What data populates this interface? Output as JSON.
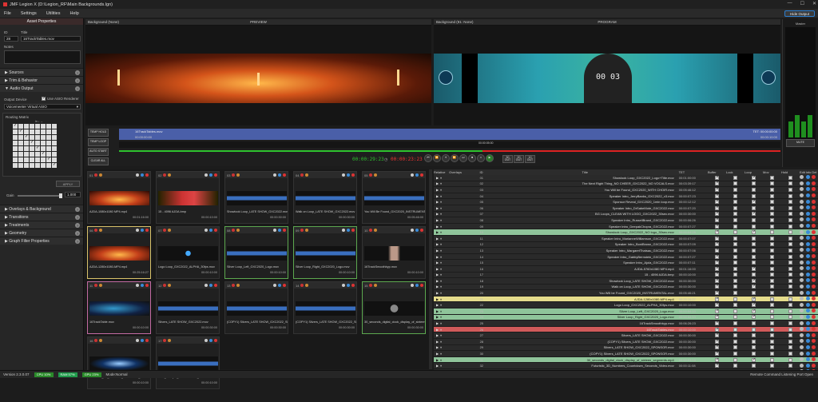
{
  "window": {
    "title": "JMF Legion X (D:\\Legion_RF\\Main Backgrounds.lgn)",
    "minimize": "—",
    "maximize": "☐",
    "close": "✕"
  },
  "menu": [
    "File",
    "Settings",
    "Utilities",
    "Help"
  ],
  "hide_output": "Hide Output",
  "asset": {
    "header": "Asset Properties",
    "id_label": "ID",
    "id_value": "28",
    "title_label": "Title",
    "title_value": "16TrackTables.mov",
    "notes_label": "Notes",
    "sections": [
      "Sources",
      "Trim & Behavior",
      "Audio Output"
    ],
    "output_device_label": "Output Device",
    "use_asio": "Use ASIO Renderer",
    "device_value": "Voicemeeter Virtual ASIO",
    "routing_label": "Routing Matrix",
    "routing_hint": "in ↓  →",
    "apply": "APPLY",
    "gain_label": "Gain",
    "gain_value": "1.000",
    "sections2": [
      "Overlays & Background",
      "Transitions",
      "Treatments",
      "Geometry",
      "Graph Filter Properties"
    ]
  },
  "preview": {
    "bg_label": "Background (None)",
    "title": "PREVIEW"
  },
  "program": {
    "bg_label": "Background (91: None)",
    "title": "PROGRAM",
    "clock": "00 03"
  },
  "meter_label": "Master",
  "mute": "MUTE",
  "timeline": {
    "clip_name": "16TrackTables.mov",
    "clip_start": "00:00:00:00",
    "clip_end_label": "TET: 00:00:00:00",
    "clip_end_time": "00:00:10:00",
    "playhead": "00:00:05:00",
    "btn_temp_hold": "TEMP HOLD",
    "btn_temp_loop": "TEMP LOOP",
    "btn_auto_start": "AUTO START",
    "btn_clear_all": "CLEAR ALL",
    "time_elapsed": "00:00:29:23",
    "time_remaining": "00:00:23:23",
    "out_buttons": [
      "30 OUT",
      "20 OUT",
      "10 OUT"
    ]
  },
  "thumbs": [
    {
      "num": "01",
      "name": "AJDA-1080x1080 MP4.mp4",
      "time": "00:01:16:00",
      "border": "#333",
      "img": "fire"
    },
    {
      "num": "02",
      "name": "15 - 4096 AJDA.bmp",
      "time": "00:00:10:00",
      "border": "#333",
      "img": "stage"
    },
    {
      "num": "03",
      "name": "Showlook Loop_LATE SHOW_GXC2022.mov",
      "time": "00:00:30:00",
      "border": "#333",
      "img": "lines"
    },
    {
      "num": "04",
      "name": "Walk on Loop_LATE SHOW_GXC2022.mov",
      "time": "00:00:30:00",
      "border": "#333",
      "img": "lines"
    },
    {
      "num": "05",
      "name": "You Will Be Found_GXC2020_INSTRUMENTAL.mov",
      "time": "00:05:46:00",
      "border": "#333",
      "img": "lines"
    },
    {
      "num": "06",
      "name": "AJDA-1280x1080-MP4.mp4",
      "time": "00:25:16:27",
      "border": "#d9c26a",
      "img": "fire"
    },
    {
      "num": "07",
      "name": "Logo Loop_GXC2022_ALPHA_30fps.mov",
      "time": "00:00:10:00",
      "border": "#333",
      "img": "dot"
    },
    {
      "num": "08",
      "name": "Silver Loop_Left_GXC2020_Logo.mov",
      "time": "00:00:10:00",
      "border": "#5ca84f",
      "img": "lines"
    },
    {
      "num": "09",
      "name": "Silver Loop_Right_GXC2020_Logo.mov",
      "time": "00:00:10:00",
      "border": "#5ca84f",
      "img": "lines"
    },
    {
      "num": "10",
      "name": "16TrackSmoothbyp.mov",
      "time": "00:00:10:00",
      "border": "#333",
      "img": "hand"
    },
    {
      "num": "11",
      "name": "16TrackTable.mov",
      "time": "00:00:10:00",
      "border": "#c26aa2",
      "img": "blue"
    },
    {
      "num": "12",
      "name": "Silvers_LATE SHOW_GXC2022.mov",
      "time": "00:00:30:00",
      "border": "#333",
      "img": "lines"
    },
    {
      "num": "13",
      "name": "(COPY1) Silvers_LATE SHOW_GXC2022_SPONSOR.mov",
      "time": "00:00:30:00",
      "border": "#333",
      "img": "lines"
    },
    {
      "num": "14",
      "name": "(COPY1) Silvers_LATE SHOW_GXC2022_SPONSOR.mov",
      "time": "00:00:30:00",
      "border": "#333",
      "img": "lines"
    },
    {
      "num": "15",
      "name": "30_seconds_digital_clock_display_of_sixteen_se...",
      "time": "00:00:30:00",
      "border": "#5ca84f",
      "img": "clock"
    },
    {
      "num": "16",
      "name": "Futuristic_3D_Numbers_Countdown_Seconds_Video.mov",
      "time": "00:00:10:00",
      "border": "#333",
      "img": "glow"
    },
    {
      "num": "17",
      "name": "HFC_Bumper_Sharon Arthur_V2.mov",
      "time": "00:00:10:00",
      "border": "#333",
      "img": "lines"
    }
  ],
  "playlist": {
    "headers": [
      "Relative",
      "Overlays",
      "ID",
      "Title",
      "TET",
      "Buffer",
      "Lock",
      "Loop",
      "Mov",
      "Hold",
      "Edit",
      "Info",
      "Del"
    ],
    "rows": [
      {
        "id": "01",
        "title": "Showlook Loop_GXC2022_Logo+Title.mov",
        "tet": "00:01:00:00",
        "bg": "#2a2a2a",
        "loop": true
      },
      {
        "id": "02",
        "title": "The Next Right Thing_NO CHEER_GXC2022_NO VOCALS.mov",
        "tet": "00:03:39:17",
        "bg": "#2a2a2a",
        "loop": false
      },
      {
        "id": "03",
        "title": "You Will be Found_GXC2020_WITH CHOIR.mov",
        "tet": "00:05:46:12",
        "bg": "#2a2a2a",
        "loop": false
      },
      {
        "id": "04",
        "title": "Speaker Intro_JerryBanks_GXC2022_v3.mov",
        "tet": "00:00:07:23",
        "bg": "#2a2a2a",
        "loop": false
      },
      {
        "id": "05",
        "title": "Sponsor Reveal_GXC2020_1min loop.mov",
        "tet": "00:00:12:12",
        "bg": "#2a2a2a",
        "loop": true
      },
      {
        "id": "06",
        "title": "Speaker Intro_DrSabeMote_GXC2022.mov",
        "tet": "00:00:07:20",
        "bg": "#2a2a2a",
        "loop": false
      },
      {
        "id": "07",
        "title": "BG Loops_CLEAN WITH LOGO_GXC2022_30sec.mov",
        "tet": "00:00:30:00",
        "bg": "#2a2a2a",
        "loop": true
      },
      {
        "id": "08",
        "title": "Speaker Intro_RussellBrand_GXC2022.mov",
        "tet": "00:00:06:26",
        "bg": "#2a2a2a",
        "loop": false
      },
      {
        "id": "09",
        "title": "Speaker Intro_DeepakChopra_GXC2022.mov",
        "tet": "00:00:07:27",
        "bg": "#2a2a2a",
        "loop": false
      },
      {
        "id": "10",
        "title": "Showlook Loop_GXC2022_NO logo_30sec.mov",
        "tet": "00:00:04:28",
        "bg": "#8fc49a",
        "loop": true
      },
      {
        "id": "11",
        "title": "Speaker Intro_MarianneWilliamson_GXC2022.mov",
        "tet": "00:00:07:07",
        "bg": "#2a2a2a",
        "loop": false
      },
      {
        "id": "12",
        "title": "Speaker Intro_BoniBrown_GXC2022.mov",
        "tet": "00:00:07:09",
        "bg": "#2a2a2a",
        "loop": false
      },
      {
        "id": "13",
        "title": "Speaker Intro_MargaretThatsau_GXC2022.mov",
        "tet": "00:00:07:06",
        "bg": "#2a2a2a",
        "loop": false
      },
      {
        "id": "14",
        "title": "Speaker Intro_GabbyBernstein_GXC2022.mov",
        "tet": "00:00:07:27",
        "bg": "#2a2a2a",
        "loop": false
      },
      {
        "id": "15",
        "title": "Speaker Intro_Ajola_GXC2022.mov",
        "tet": "00:00:07:11",
        "bg": "#2a2a2a",
        "loop": false
      },
      {
        "id": "16",
        "title": "AJDA-5760x1080 MP4.mp4",
        "tet": "00:01:16:00",
        "bg": "#2a2a2a",
        "loop": true
      },
      {
        "id": "17",
        "title": "15 - 4096 AJDA.bmp",
        "tet": "00:00:10:00",
        "bg": "#2a2a2a",
        "loop": false
      },
      {
        "id": "18",
        "title": "Showlook Loop_LATE SHOW_GXC2022.mov",
        "tet": "00:00:30:00",
        "bg": "#2a2a2a",
        "loop": true
      },
      {
        "id": "19",
        "title": "Walk on Loop_LATE SHOW_GXC2022.mov",
        "tet": "00:00:30:00",
        "bg": "#2a2a2a",
        "loop": true
      },
      {
        "id": "20",
        "title": "You Will be Found_GXC2020_INSTRUMENTAL.mov",
        "tet": "00:05:46:21",
        "bg": "#2a2a2a",
        "loop": false
      },
      {
        "id": "21",
        "title": "AJDA-1280x1080-MP4.mp4",
        "tet": "00:25:16:27",
        "bg": "#e5dc8c",
        "loop": true
      },
      {
        "id": "22",
        "title": "Logo Loop_GXC2022_ALPHA_30fps.mov",
        "tet": "00:00:10:00",
        "bg": "#2a2a2a",
        "loop": true
      },
      {
        "id": "23",
        "title": "Silver Loop_Left_GXC2020_Logo.mov",
        "tet": "00:00:54:10",
        "bg": "#8fc49a",
        "loop": true
      },
      {
        "id": "24",
        "title": "Silver Loop_Right_GXC2020_Logo.mov",
        "tet": "00:00:54:10",
        "bg": "#8fc49a",
        "loop": true
      },
      {
        "id": "25",
        "title": "16TrackSmoothbyp.mov",
        "tet": "00:06:26:23",
        "bg": "#2a2a2a",
        "loop": false
      },
      {
        "id": "26",
        "title": "16TrackTables.mov",
        "tet": "00:00:10:00",
        "bg": "#d05a5a",
        "loop": false
      },
      {
        "id": "27",
        "title": "Silvers_LATE SHOW_GXC2022.mov",
        "tet": "00:00:30:00",
        "bg": "#2a2a2a",
        "loop": false
      },
      {
        "id": "28",
        "title": "(COPY1) Silvers_LATE SHOW_GXC2022.mov",
        "tet": "00:00:30:00",
        "bg": "#2a2a2a",
        "loop": false
      },
      {
        "id": "29",
        "title": "Silvers_LATE SHOW_GXC2022_SPONSOR.mov",
        "tet": "00:00:30:00",
        "bg": "#2a2a2a",
        "loop": false
      },
      {
        "id": "30",
        "title": "(COPY1) Silvers_LATE SHOW_GXC2022_SPONSOR.mov",
        "tet": "00:00:30:00",
        "bg": "#2a2a2a",
        "loop": false
      },
      {
        "id": "31",
        "title": "30_seconds_digital_clock_display_of_sixteen_segments.mp4",
        "tet": "00:00:03:03",
        "bg": "#8fc49a",
        "loop": true
      },
      {
        "id": "32",
        "title": "Futuristic_3D_Numbers_Countdown_Seconds_Video.mov",
        "tet": "00:00:11:08",
        "bg": "#2a2a2a",
        "loop": false
      },
      {
        "id": "33",
        "title": "HFC_Bumper_Sharon Arthur_V2.mov",
        "tet": "00:00:10:00",
        "bg": "#2a2a2a",
        "loop": false
      }
    ]
  },
  "status": {
    "version": "Version 2.3.0.07",
    "cpu": "CPU 10%",
    "ram": "RAM 57%",
    "gpu": "GPU 23%",
    "mode": "Mode:Normal",
    "remote": "Remote Command Listening Port Open"
  }
}
